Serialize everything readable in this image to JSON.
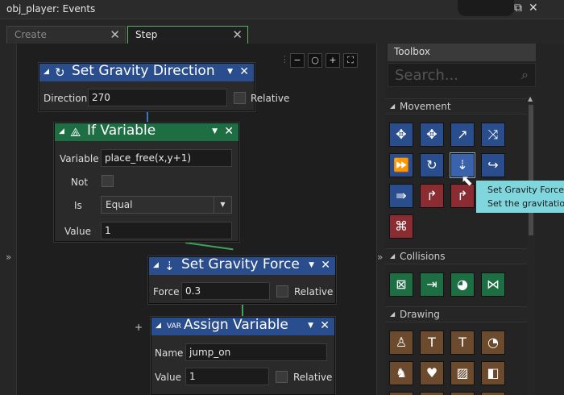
{
  "window": {
    "title": "obj_player: Events"
  },
  "tabs": [
    {
      "label": "Create",
      "active": false
    },
    {
      "label": "Step",
      "active": true
    }
  ],
  "zoom_toolbar": {
    "icons": [
      "zoom-out-icon",
      "zoom-reset-icon",
      "zoom-in-icon",
      "fit-screen-icon"
    ]
  },
  "blocks": {
    "gravity_direction": {
      "title": "Set Gravity Direction",
      "direction_label": "Direction",
      "direction_value": "270",
      "relative_label": "Relative",
      "relative_checked": false
    },
    "if_variable": {
      "title": "If Variable",
      "variable_label": "Variable",
      "variable_value": "place_free(x,y+1)",
      "not_label": "Not",
      "not_checked": false,
      "is_label": "Is",
      "is_value": "Equal",
      "value_label": "Value",
      "value_value": "1"
    },
    "gravity_force": {
      "title": "Set Gravity Force",
      "force_label": "Force",
      "force_value": "0.3",
      "relative_label": "Relative",
      "relative_checked": false
    },
    "assign_variable": {
      "title": "Assign Variable",
      "name_label": "Name",
      "name_value": "jump_on",
      "value_label": "Value",
      "value_value": "1",
      "relative_label": "Relative",
      "relative_checked": false
    }
  },
  "toolbox": {
    "header": "Toolbox",
    "search_placeholder": "Search...",
    "sections": [
      {
        "name": "Movement"
      },
      {
        "name": "Collisions"
      },
      {
        "name": "Drawing"
      }
    ]
  },
  "tooltip": {
    "line1": "Set Gravity Force",
    "line2": "Set the gravitational"
  },
  "colors": {
    "action_blue": "#2a4d8e",
    "condition_green": "#1e6e44",
    "movement_red": "#8a2c32",
    "drawing_brown": "#6b4a2d",
    "tab_accent": "#5ab06a",
    "tooltip_bg": "#7fd6dc"
  }
}
